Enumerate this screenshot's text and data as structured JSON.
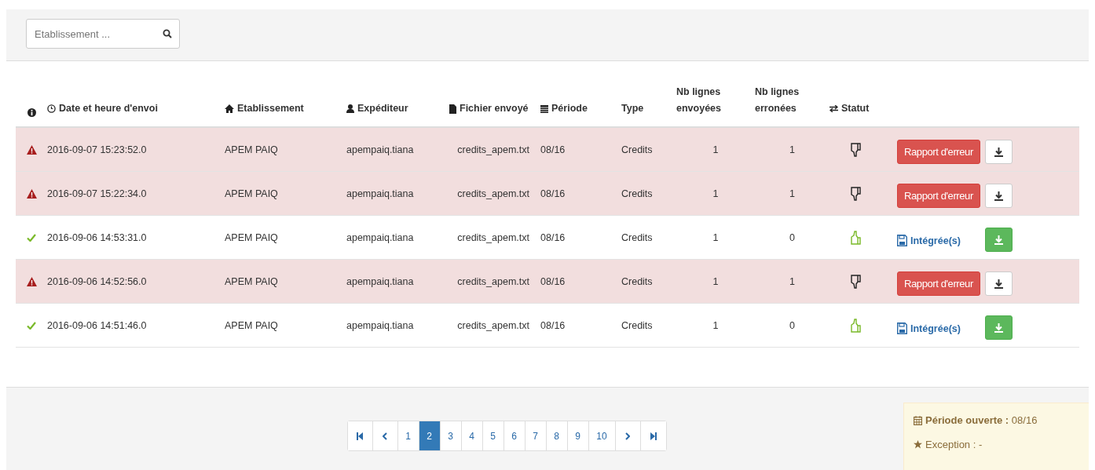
{
  "search": {
    "placeholder": "Etablissement ..."
  },
  "table": {
    "columns": [
      {
        "kind": "info"
      },
      {
        "kind": "clock",
        "label": "Date et heure d'envoi"
      },
      {
        "kind": "home",
        "label": "Etablissement"
      },
      {
        "kind": "user",
        "label": "Expéditeur"
      },
      {
        "kind": "file",
        "label": "Fichier envoyé"
      },
      {
        "kind": "calendar",
        "label": "Période"
      },
      {
        "kind": "plain",
        "label": "Type"
      },
      {
        "kind": "plain",
        "label": "Nb lignes envoyées"
      },
      {
        "kind": "plain",
        "label": "Nb lignes erronées"
      },
      {
        "kind": "exchange",
        "label": "Statut"
      }
    ],
    "rows": [
      {
        "kind": "error",
        "date": "2016-09-07 15:23:52.0",
        "etablissement": "APEM PAIQ",
        "expediteur": "apempaiq.tiana",
        "fichier": "credits_apem.txt",
        "periode": "08/16",
        "type": "Credits",
        "envoyees": "1",
        "erronees": "1",
        "action": "Rapport d'erreur"
      },
      {
        "kind": "error",
        "date": "2016-09-07 15:22:34.0",
        "etablissement": "APEM PAIQ",
        "expediteur": "apempaiq.tiana",
        "fichier": "credits_apem.txt",
        "periode": "08/16",
        "type": "Credits",
        "envoyees": "1",
        "erronees": "1",
        "action": "Rapport d'erreur"
      },
      {
        "kind": "ok",
        "date": "2016-09-06 14:53:31.0",
        "etablissement": "APEM PAIQ",
        "expediteur": "apempaiq.tiana",
        "fichier": "credits_apem.txt",
        "periode": "08/16",
        "type": "Credits",
        "envoyees": "1",
        "erronees": "0",
        "action": "Intégrée(s)"
      },
      {
        "kind": "error",
        "date": "2016-09-06 14:52:56.0",
        "etablissement": "APEM PAIQ",
        "expediteur": "apempaiq.tiana",
        "fichier": "credits_apem.txt",
        "periode": "08/16",
        "type": "Credits",
        "envoyees": "1",
        "erronees": "1",
        "action": "Rapport d'erreur"
      },
      {
        "kind": "ok",
        "date": "2016-09-06 14:51:46.0",
        "etablissement": "APEM PAIQ",
        "expediteur": "apempaiq.tiana",
        "fichier": "credits_apem.txt",
        "periode": "08/16",
        "type": "Credits",
        "envoyees": "1",
        "erronees": "0",
        "action": "Intégrée(s)"
      }
    ]
  },
  "pagination": {
    "pages": [
      {
        "label": "1",
        "selected": false
      },
      {
        "label": "2",
        "selected": true
      },
      {
        "label": "3",
        "selected": false
      },
      {
        "label": "4",
        "selected": false
      },
      {
        "label": "5",
        "selected": false
      },
      {
        "label": "6",
        "selected": false
      },
      {
        "label": "7",
        "selected": false
      },
      {
        "label": "8",
        "selected": false
      },
      {
        "label": "9",
        "selected": false
      },
      {
        "label": "10",
        "selected": false
      }
    ]
  },
  "info": {
    "periode_label": "Période ouverte :",
    "periode_value": "08/16",
    "exception": "Exception : -"
  }
}
